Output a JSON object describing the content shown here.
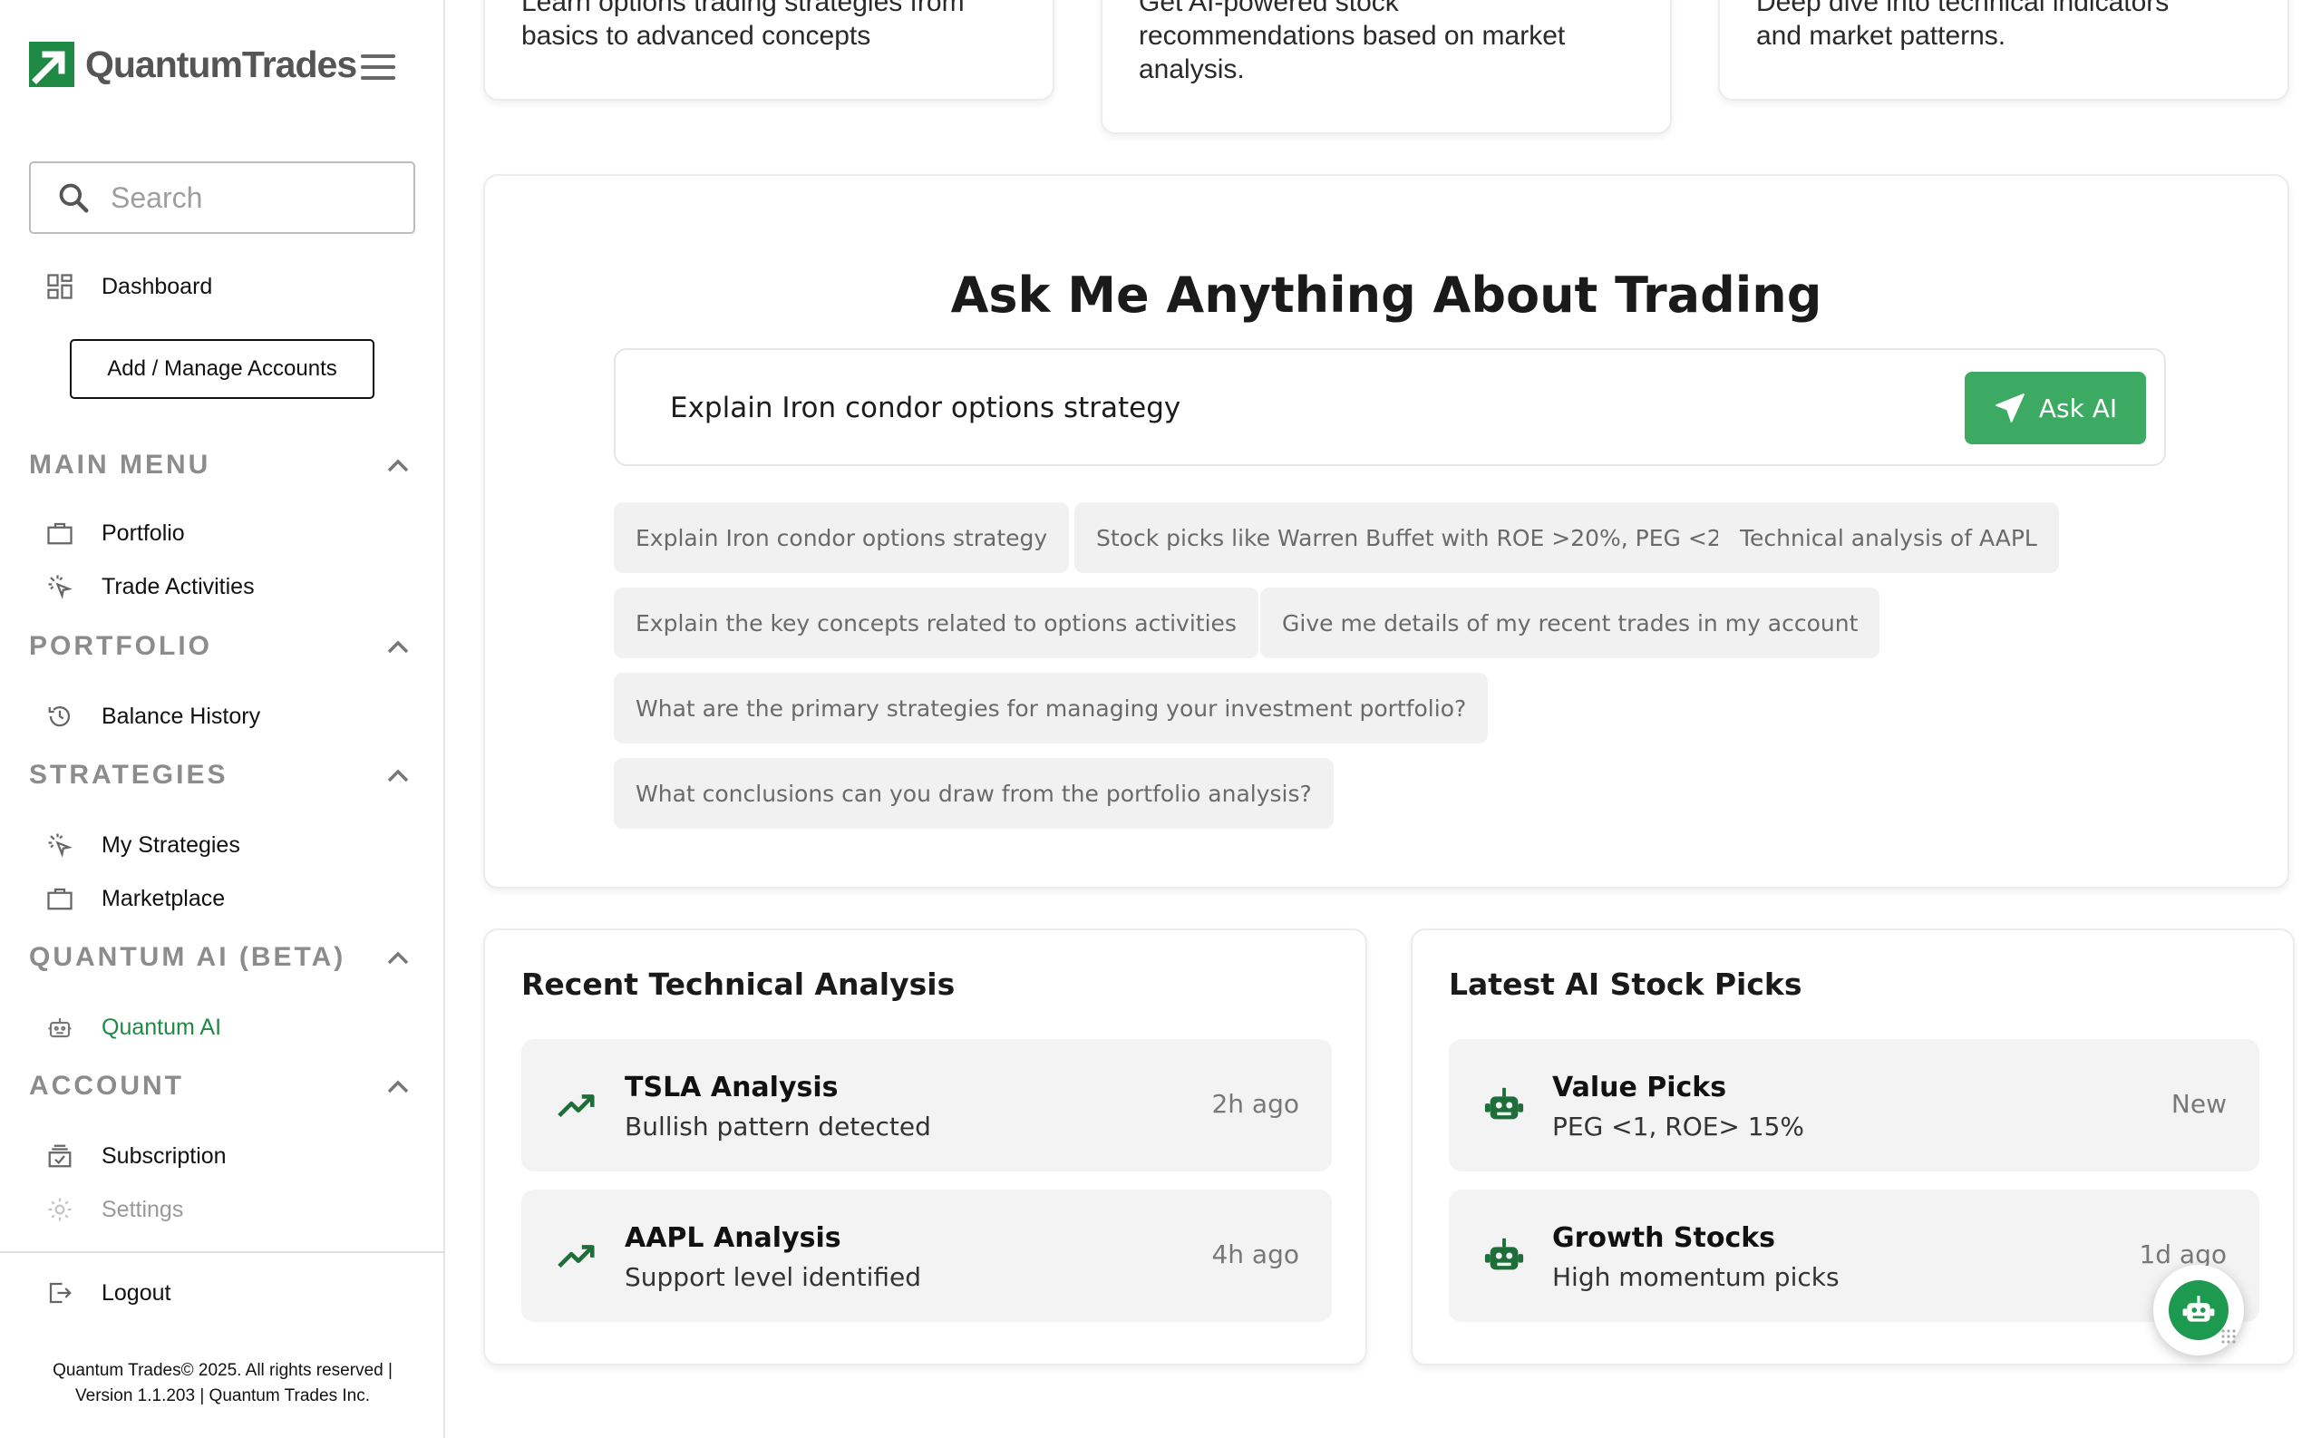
{
  "app": {
    "name": "QuantumTrades",
    "brand_color": "#1e8a44",
    "accent_color": "#3daa63"
  },
  "sidebar": {
    "search_placeholder": "Search",
    "dashboard_label": "Dashboard",
    "manage_accounts_label": "Add / Manage Accounts",
    "sections": {
      "main_menu": {
        "title": "MAIN MENU",
        "items": [
          "Portfolio",
          "Trade Activities"
        ]
      },
      "portfolio": {
        "title": "PORTFOLIO",
        "items": [
          "Balance History"
        ]
      },
      "strategies": {
        "title": "STRATEGIES",
        "items": [
          "My Strategies",
          "Marketplace"
        ]
      },
      "quantum_ai": {
        "title": "QUANTUM AI (BETA)",
        "items": [
          "Quantum AI"
        ]
      },
      "account": {
        "title": "ACCOUNT",
        "items": [
          "Subscription",
          "Settings"
        ]
      }
    },
    "logout_label": "Logout",
    "footer_line1": "Quantum Trades© 2025. All rights reserved |",
    "footer_line2": "Version 1.1.203 | Quantum Trades Inc."
  },
  "top_cards": [
    {
      "line1": "Learn options trading strategies from",
      "line2": "basics to advanced concepts"
    },
    {
      "line1": "Get AI-powered stock",
      "line2": "recommendations based on market",
      "line3": "analysis."
    },
    {
      "line1": "Deep dive into technical indicators",
      "line2": "and market patterns."
    }
  ],
  "ama": {
    "title": "Ask Me Anything About Trading",
    "input_value": "Explain Iron condor options strategy",
    "button_label": "Ask AI",
    "suggestions": [
      "Explain Iron condor options strategy",
      "Stock picks like Warren Buffet with ROE >20%, PEG <2",
      "Technical analysis of AAPL",
      "Explain the key concepts related to options activities",
      "Give me details of my recent trades in my account",
      "What are the primary strategies for managing your investment portfolio?",
      "What conclusions can you draw from the portfolio analysis?"
    ]
  },
  "technical_analysis": {
    "title": "Recent Technical Analysis",
    "items": [
      {
        "title": "TSLA Analysis",
        "subtitle": "Bullish pattern detected",
        "time": "2h ago",
        "icon": "trending-up-icon"
      },
      {
        "title": "AAPL Analysis",
        "subtitle": "Support level identified",
        "time": "4h ago",
        "icon": "trending-up-icon"
      }
    ]
  },
  "stock_picks": {
    "title": "Latest AI Stock Picks",
    "items": [
      {
        "title": "Value Picks",
        "subtitle": "PEG <1, ROE> 15%",
        "time": "New",
        "icon": "robot-icon"
      },
      {
        "title": "Growth Stocks",
        "subtitle": "High momentum picks",
        "time": "1d ago",
        "icon": "robot-icon"
      }
    ]
  }
}
